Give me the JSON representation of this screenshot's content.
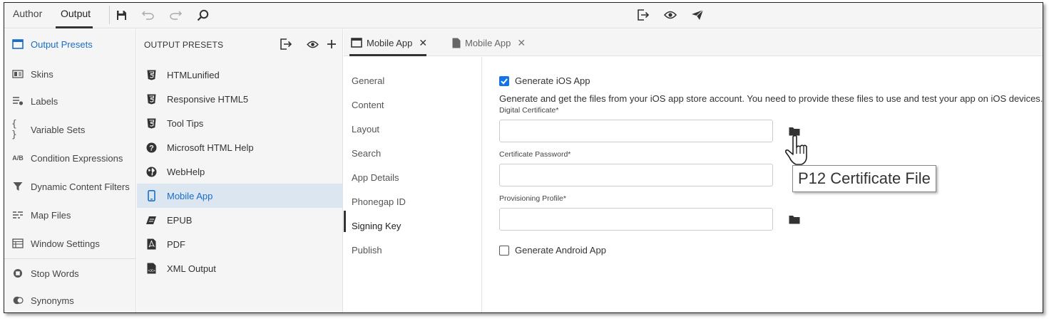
{
  "toolbar": {
    "author_tab": "Author",
    "output_tab": "Output",
    "icons": [
      "save-icon",
      "undo-icon",
      "redo-icon",
      "search-icon",
      "generate-icon",
      "preview-icon",
      "publish-icon"
    ]
  },
  "leftnav": {
    "items": [
      {
        "label": "Output Presets",
        "icon": "window-icon",
        "active": true
      },
      {
        "label": "Skins",
        "icon": "skin-icon"
      },
      {
        "label": "Labels",
        "icon": "labels-icon"
      },
      {
        "label": "Variable Sets",
        "icon": "braces-icon"
      },
      {
        "label": "Condition Expressions",
        "icon": "ab-icon"
      },
      {
        "label": "Dynamic Content Filters",
        "icon": "filter-icon"
      },
      {
        "label": "Map Files",
        "icon": "map-files-icon"
      },
      {
        "label": "Window Settings",
        "icon": "window-settings-icon"
      },
      {
        "label": "Stop Words",
        "icon": "stop-icon"
      },
      {
        "label": "Synonyms",
        "icon": "synonyms-icon"
      }
    ]
  },
  "presets": {
    "heading": "OUTPUT PRESETS",
    "items": [
      {
        "label": "HTMLunified",
        "icon": "html5-icon"
      },
      {
        "label": "Responsive HTML5",
        "icon": "html5-icon"
      },
      {
        "label": "Tool Tips",
        "icon": "html5-icon"
      },
      {
        "label": "Microsoft HTML Help",
        "icon": "help-icon"
      },
      {
        "label": "WebHelp",
        "icon": "globe-icon"
      },
      {
        "label": "Mobile App",
        "icon": "mobile-icon",
        "selected": true
      },
      {
        "label": "EPUB",
        "icon": "epub-icon"
      },
      {
        "label": "PDF",
        "icon": "pdf-icon"
      },
      {
        "label": "XML Output",
        "icon": "xml-icon"
      }
    ]
  },
  "doctabs": [
    {
      "label": "Mobile App",
      "active": true
    },
    {
      "label": "Mobile App",
      "active": false
    }
  ],
  "settings_nav": [
    "General",
    "Content",
    "Layout",
    "Search",
    "App Details",
    "Phonegap ID",
    "Signing Key",
    "Publish"
  ],
  "settings_active": "Signing Key",
  "form": {
    "generate_ios": {
      "label": "Generate iOS App",
      "checked": true
    },
    "description": "Generate and get the files from your iOS app store account. You need to provide these files to use and test your app on iOS devices.",
    "digital_certificate": {
      "label": "Digital Certificate*",
      "value": ""
    },
    "certificate_password": {
      "label": "Certificate Password*",
      "value": ""
    },
    "provisioning_profile": {
      "label": "Provisioning Profile*",
      "value": ""
    },
    "generate_android": {
      "label": "Generate Android App",
      "checked": false
    },
    "tooltip": "P12 Certificate File"
  },
  "colors": {
    "accent": "#1a6dc7",
    "checkbox": "#1473e6",
    "selected_row": "#dce6f0"
  }
}
